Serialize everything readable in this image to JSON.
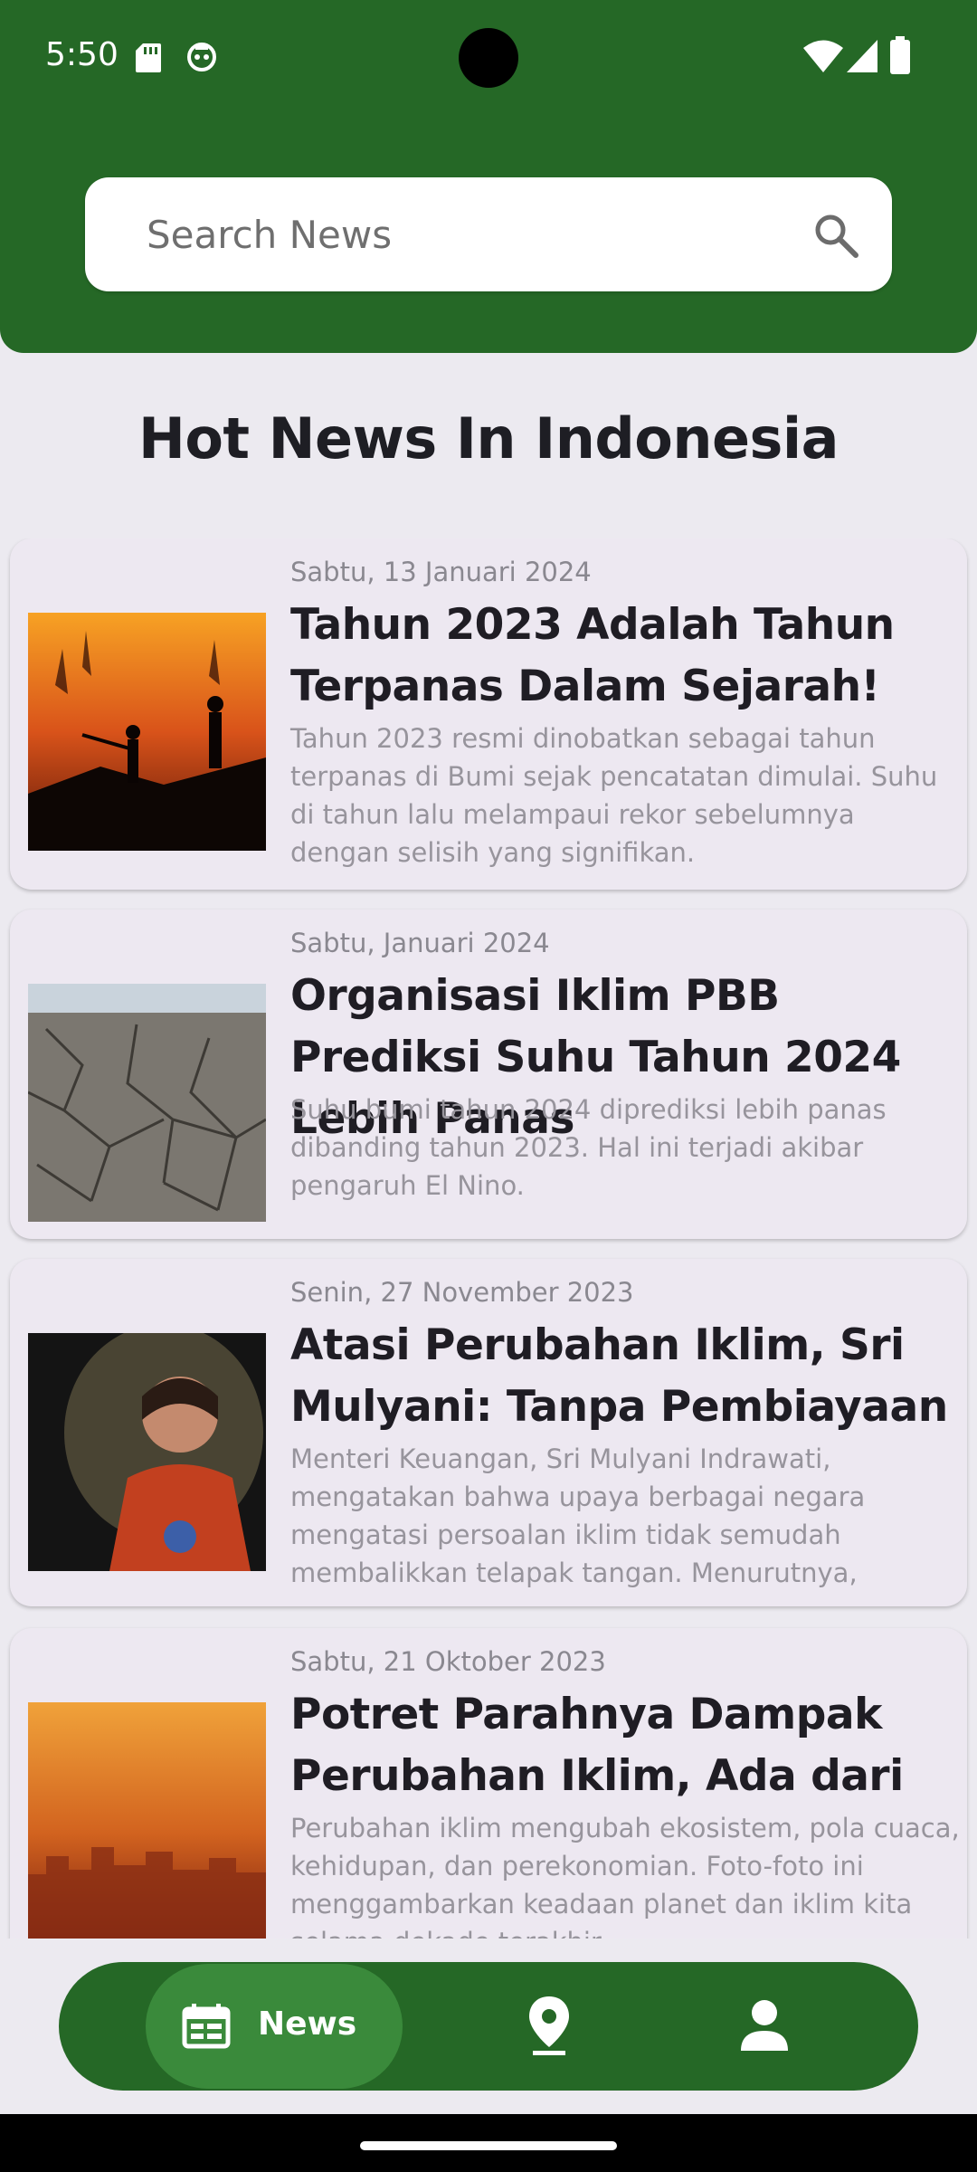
{
  "status_bar": {
    "time": "5:50",
    "icons": [
      "sd-card-icon",
      "sync-icon",
      "wifi-icon",
      "signal-icon",
      "battery-icon"
    ]
  },
  "search": {
    "placeholder": "Search News",
    "value": ""
  },
  "page_title": "Hot News In Indonesia",
  "news": [
    {
      "date": "Sabtu, 13 Januari 2024",
      "title": "Tahun 2023 Adalah Tahun Terpanas Dalam Sejarah!",
      "description": "Tahun 2023 resmi dinobatkan sebagai tahun terpanas di Bumi sejak pencatatan dimulai. Suhu di tahun lalu melampaui rekor sebelumnya dengan selisih yang signifikan.",
      "image": "forest-fire-photo"
    },
    {
      "date": "Sabtu, Januari 2024",
      "title": "Organisasi Iklim PBB Prediksi Suhu Tahun 2024 Lebih Panas",
      "description": "Suhu bumi tahun 2024 diprediksi lebih panas dibanding tahun 2023. Hal ini terjadi akibar pengaruh El Nino.",
      "image": "dry-cracked-land-photo"
    },
    {
      "date": "Senin, 27 November 2023",
      "title": "Atasi Perubahan Iklim, Sri Mulyani: Tanpa Pembiayaan",
      "description": "Menteri Keuangan, Sri Mulyani Indrawati, mengatakan bahwa upaya berbagai negara mengatasi persoalan iklim tidak semudah membalikkan telapak tangan. Menurutnya, agenda",
      "image": "speaker-portrait-photo"
    },
    {
      "date": "Sabtu, 21 Oktober 2023",
      "title": "Potret Parahnya Dampak Perubahan Iklim, Ada dari",
      "description": "Perubahan iklim mengubah ekosistem, pola cuaca, kehidupan, dan perekonomian. Foto-foto ini menggambarkan keadaan planet dan iklim kita selama dekade terakhir.",
      "image": "hazy-city-sunset-photo"
    }
  ],
  "bottom_nav": {
    "items": [
      {
        "label": "News",
        "icon": "newspaper-icon",
        "active": true
      },
      {
        "label": "",
        "icon": "location-pin-icon",
        "active": false
      },
      {
        "label": "",
        "icon": "person-icon",
        "active": false
      }
    ]
  },
  "colors": {
    "primary": "#256826",
    "nav_active": "#3A8A3B",
    "background": "#ECEAF0",
    "card": "#EDE8F1"
  }
}
